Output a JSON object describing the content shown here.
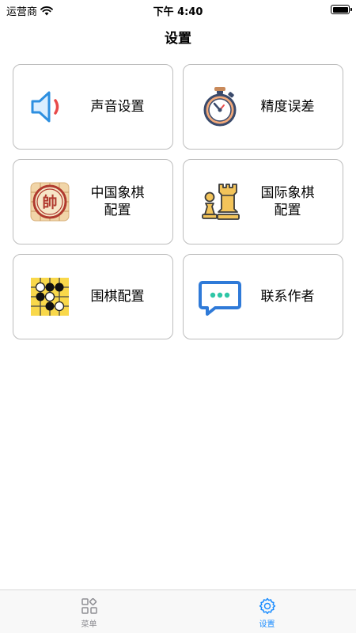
{
  "status_bar": {
    "carrier": "运营商",
    "time": "下午 4:40"
  },
  "nav": {
    "title": "设置"
  },
  "cards": [
    {
      "label": "声音设置",
      "icon": "speaker-icon"
    },
    {
      "label": "精度误差",
      "icon": "stopwatch-icon"
    },
    {
      "label": "中国象棋\n配置",
      "icon": "xiangqi-shuai-piece-icon"
    },
    {
      "label": "国际象棋\n配置",
      "icon": "chess-pieces-icon"
    },
    {
      "label": "围棋配置",
      "icon": "go-board-icon"
    },
    {
      "label": "联系作者",
      "icon": "chat-bubble-icon"
    }
  ],
  "tabs": [
    {
      "label": "菜单",
      "icon": "grid-menu-icon",
      "active": false
    },
    {
      "label": "设置",
      "icon": "gear-icon",
      "active": true
    }
  ],
  "colors": {
    "accent": "#1a8cff",
    "inactive_tab": "#8e8e93",
    "card_border": "#bdbdbd"
  }
}
